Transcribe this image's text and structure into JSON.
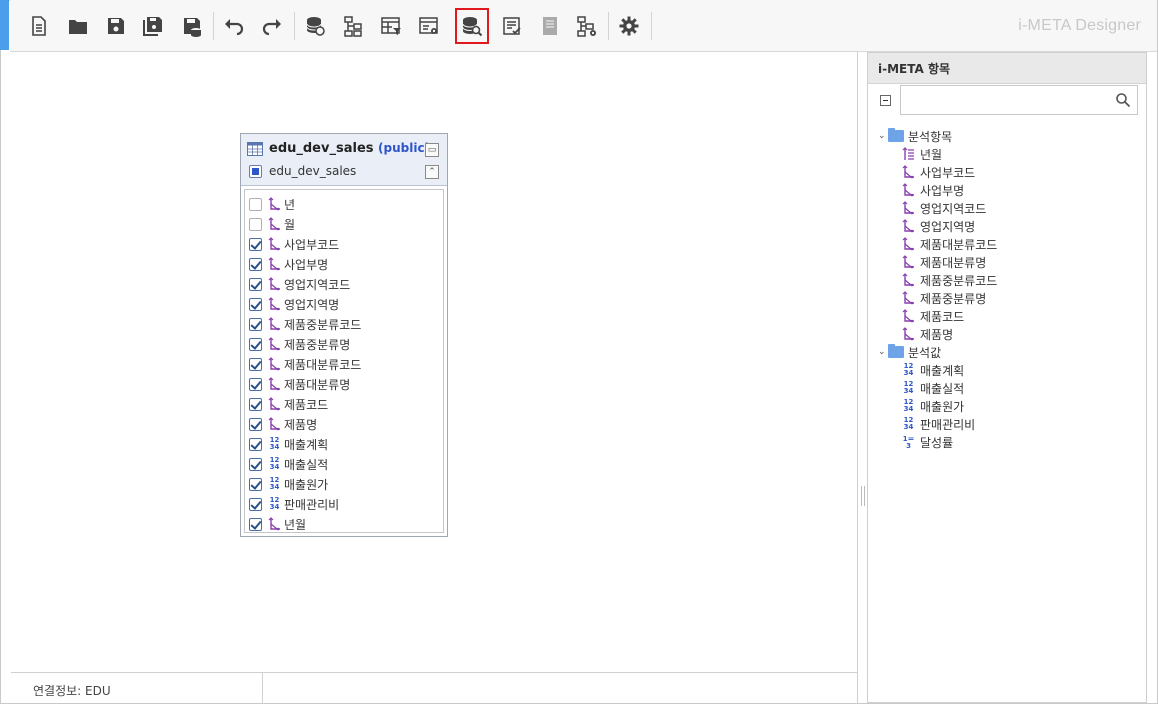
{
  "app": {
    "title": "i-META Designer"
  },
  "toolbar": {
    "buttons": [
      {
        "name": "new-document-icon"
      },
      {
        "name": "open-folder-icon"
      },
      {
        "name": "save-icon"
      },
      {
        "name": "save-as-icon"
      },
      {
        "name": "save-db-icon"
      },
      {
        "name": "undo-icon"
      },
      {
        "name": "redo-icon"
      },
      {
        "name": "datasource-icon"
      },
      {
        "name": "hierarchy-icon"
      },
      {
        "name": "table-filter-icon"
      },
      {
        "name": "table-settings-icon"
      },
      {
        "name": "db-search-icon"
      },
      {
        "name": "checklist-icon"
      },
      {
        "name": "document-icon"
      },
      {
        "name": "tree-settings-icon"
      },
      {
        "name": "gear-icon"
      }
    ],
    "active": "db-search-icon"
  },
  "table_box": {
    "name": "edu_dev_sales",
    "schema": "(public)",
    "subtitle": "edu_dev_sales",
    "columns": [
      {
        "label": "년",
        "type": "dimension",
        "checked": false
      },
      {
        "label": "월",
        "type": "dimension",
        "checked": false
      },
      {
        "label": "사업부코드",
        "type": "dimension",
        "checked": true
      },
      {
        "label": "사업부명",
        "type": "dimension",
        "checked": true
      },
      {
        "label": "영업지역코드",
        "type": "dimension",
        "checked": true
      },
      {
        "label": "영업지역명",
        "type": "dimension",
        "checked": true
      },
      {
        "label": "제품중분류코드",
        "type": "dimension",
        "checked": true
      },
      {
        "label": "제품중분류명",
        "type": "dimension",
        "checked": true
      },
      {
        "label": "제품대분류코드",
        "type": "dimension",
        "checked": true
      },
      {
        "label": "제품대분류명",
        "type": "dimension",
        "checked": true
      },
      {
        "label": "제품코드",
        "type": "dimension",
        "checked": true
      },
      {
        "label": "제품명",
        "type": "dimension",
        "checked": true
      },
      {
        "label": "매출계획",
        "type": "measure",
        "checked": true
      },
      {
        "label": "매출실적",
        "type": "measure",
        "checked": true
      },
      {
        "label": "매출원가",
        "type": "measure",
        "checked": true
      },
      {
        "label": "판매관리비",
        "type": "measure",
        "checked": true
      },
      {
        "label": "년월",
        "type": "dimension",
        "checked": true
      }
    ]
  },
  "status": {
    "connection": "연결정보: EDU"
  },
  "panel": {
    "title": "i-META 항목",
    "search_placeholder": "",
    "groups": [
      {
        "label": "분석항목",
        "items": [
          {
            "label": "년월",
            "type": "date-dimension"
          },
          {
            "label": "사업부코드",
            "type": "dimension"
          },
          {
            "label": "사업부명",
            "type": "dimension"
          },
          {
            "label": "영업지역코드",
            "type": "dimension"
          },
          {
            "label": "영업지역명",
            "type": "dimension"
          },
          {
            "label": "제품대분류코드",
            "type": "dimension"
          },
          {
            "label": "제품대분류명",
            "type": "dimension"
          },
          {
            "label": "제품중분류코드",
            "type": "dimension"
          },
          {
            "label": "제품중분류명",
            "type": "dimension"
          },
          {
            "label": "제품코드",
            "type": "dimension"
          },
          {
            "label": "제품명",
            "type": "dimension"
          }
        ]
      },
      {
        "label": "분석값",
        "items": [
          {
            "label": "매출계획",
            "type": "measure"
          },
          {
            "label": "매출실적",
            "type": "measure"
          },
          {
            "label": "매출원가",
            "type": "measure"
          },
          {
            "label": "판매관리비",
            "type": "measure"
          },
          {
            "label": "달성률",
            "type": "calc-measure"
          }
        ]
      }
    ]
  },
  "colors": {
    "accent": "#4a9eea",
    "schema": "#2f56c8",
    "dimension_icon": "#8a3fb0",
    "measure_icon": "#2f56c8",
    "folder": "#6ea3e8",
    "active_border": "#e0191f"
  }
}
